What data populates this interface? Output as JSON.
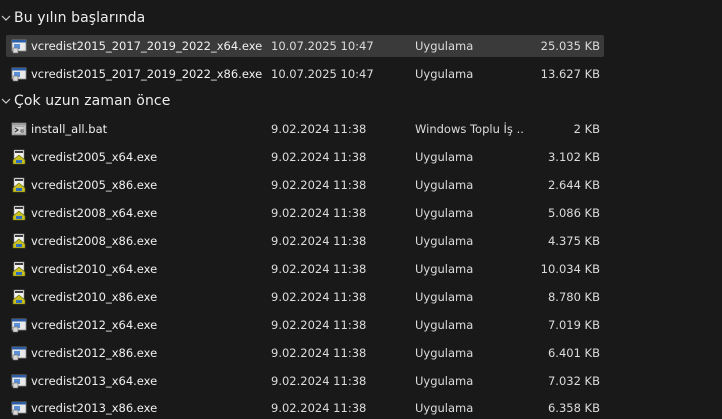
{
  "groups": [
    {
      "label": "Bu yılın başlarında",
      "rows": [
        {
          "name": "vcredist2015_2017_2019_2022_x64.exe",
          "date": "10.07.2025 10:47",
          "type": "Uygulama",
          "size": "25.035 KB",
          "icon": "installer-exe-icon"
        },
        {
          "name": "vcredist2015_2017_2019_2022_x86.exe",
          "date": "10.07.2025 10:47",
          "type": "Uygulama",
          "size": "13.627 KB",
          "icon": "installer-exe-icon"
        }
      ]
    },
    {
      "label": "Çok uzun zaman önce",
      "rows": [
        {
          "name": "install_all.bat",
          "date": "9.02.2024 11:38",
          "type": "Windows Toplu İş ...",
          "size": "2 KB",
          "icon": "batch-file-icon"
        },
        {
          "name": "vcredist2005_x64.exe",
          "date": "9.02.2024 11:38",
          "type": "Uygulama",
          "size": "3.102 KB",
          "icon": "installer-exe-icon"
        },
        {
          "name": "vcredist2005_x86.exe",
          "date": "9.02.2024 11:38",
          "type": "Uygulama",
          "size": "2.644 KB",
          "icon": "installer-exe-icon"
        },
        {
          "name": "vcredist2008_x64.exe",
          "date": "9.02.2024 11:38",
          "type": "Uygulama",
          "size": "5.086 KB",
          "icon": "installer-exe-icon"
        },
        {
          "name": "vcredist2008_x86.exe",
          "date": "9.02.2024 11:38",
          "type": "Uygulama",
          "size": "4.375 KB",
          "icon": "installer-exe-icon"
        },
        {
          "name": "vcredist2010_x64.exe",
          "date": "9.02.2024 11:38",
          "type": "Uygulama",
          "size": "10.034 KB",
          "icon": "installer-exe-icon"
        },
        {
          "name": "vcredist2010_x86.exe",
          "date": "9.02.2024 11:38",
          "type": "Uygulama",
          "size": "8.780 KB",
          "icon": "installer-exe-icon"
        },
        {
          "name": "vcredist2012_x64.exe",
          "date": "9.02.2024 11:38",
          "type": "Uygulama",
          "size": "7.019 KB",
          "icon": "installer-exe-icon"
        },
        {
          "name": "vcredist2012_x86.exe",
          "date": "9.02.2024 11:38",
          "type": "Uygulama",
          "size": "6.401 KB",
          "icon": "installer-exe-icon"
        },
        {
          "name": "vcredist2013_x64.exe",
          "date": "9.02.2024 11:38",
          "type": "Uygulama",
          "size": "7.032 KB",
          "icon": "installer-exe-icon"
        },
        {
          "name": "vcredist2013_x86.exe",
          "date": "9.02.2024 11:38",
          "type": "Uygulama",
          "size": "6.358 KB",
          "icon": "installer-exe-icon"
        }
      ]
    }
  ],
  "selected_row": "vcredist2015_2017_2019_2022_x64.exe",
  "colors": {
    "background": "#191919",
    "selection": "#3a3a3a",
    "text": "#e6e6e6"
  }
}
